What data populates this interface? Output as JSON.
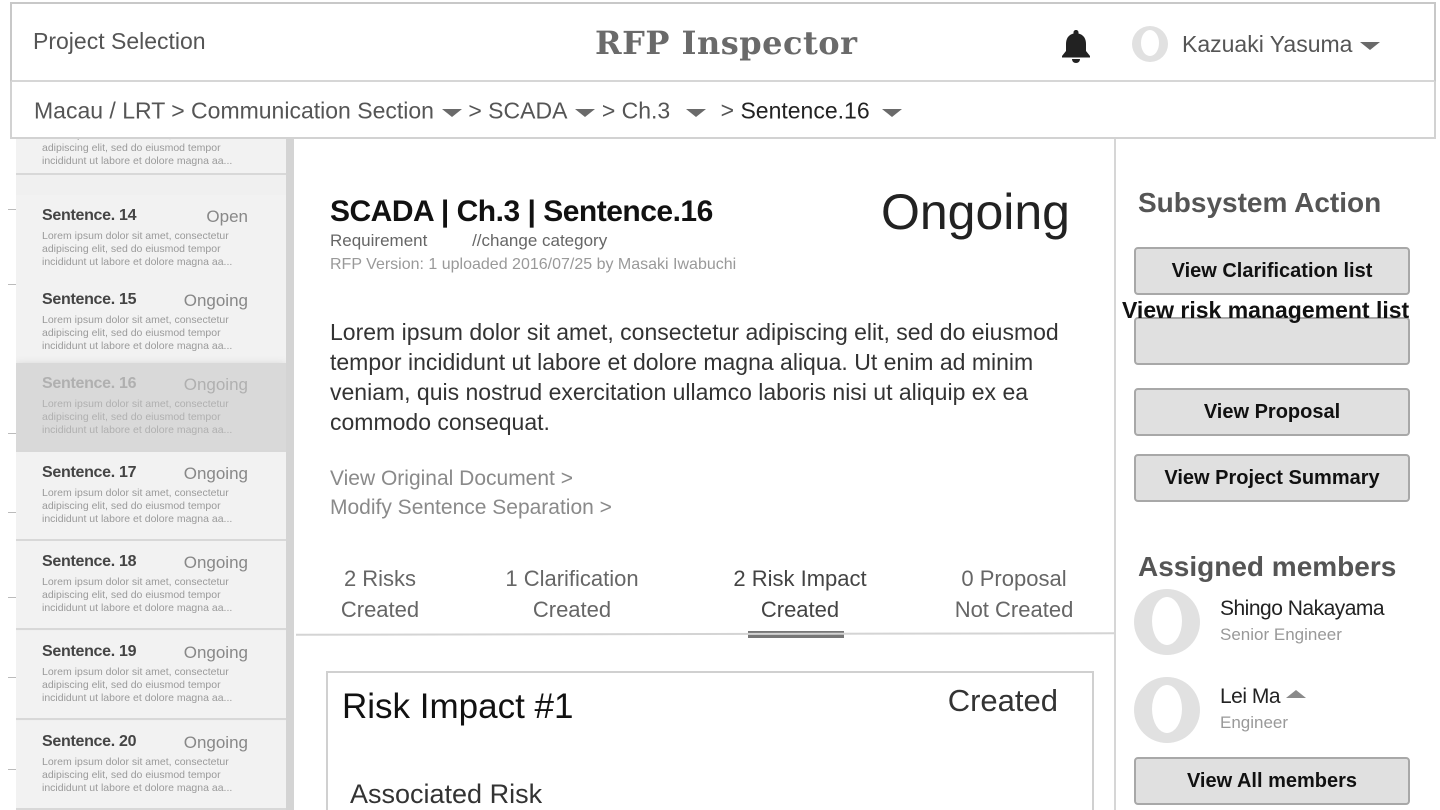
{
  "header": {
    "project_selection": "Project Selection",
    "app_title": "RFP Inspector",
    "user_name": "Kazuaki Yasuma"
  },
  "breadcrumb": {
    "root": "Macau / LRT >",
    "section": "Communication Section",
    "sep1": ">",
    "subsystem": "SCADA",
    "sep2": ">",
    "chapter": "Ch.3",
    "sep3": ">",
    "sentence": "Sentence.16"
  },
  "sidebar": {
    "top_snippet": "Lorem ipsum dolor sit amet, consectetur adipiscing elit, sed do eiusmod tempor incididunt ut labore et dolore magna aa...",
    "items": [
      {
        "title": "Sentence. 14",
        "status": "Open",
        "snippet": "Lorem ipsum dolor sit amet, consectetur adipiscing elit, sed do eiusmod tempor incididunt ut labore et dolore magna aa..."
      },
      {
        "title": "Sentence. 15",
        "status": "Ongoing",
        "snippet": "Lorem ipsum dolor sit amet, consectetur adipiscing elit, sed do eiusmod tempor incididunt ut labore et dolore magna aa..."
      },
      {
        "title": "Sentence. 16",
        "status": "Ongoing",
        "snippet": "Lorem ipsum dolor sit amet, consectetur adipiscing elit, sed do eiusmod tempor incididunt ut labore et dolore magna aa..."
      },
      {
        "title": "Sentence. 17",
        "status": "Ongoing",
        "snippet": "Lorem ipsum dolor sit amet, consectetur adipiscing elit, sed do eiusmod tempor incididunt ut labore et dolore magna aa..."
      },
      {
        "title": "Sentence. 18",
        "status": "Ongoing",
        "snippet": "Lorem ipsum dolor sit amet, consectetur adipiscing elit, sed do eiusmod tempor incididunt ut labore et dolore magna aa..."
      },
      {
        "title": "Sentence. 19",
        "status": "Ongoing",
        "snippet": "Lorem ipsum dolor sit amet, consectetur adipiscing elit, sed do eiusmod tempor incididunt ut labore et dolore magna aa..."
      },
      {
        "title": "Sentence. 20",
        "status": "Ongoing",
        "snippet": "Lorem ipsum dolor sit amet, consectetur adipiscing elit, sed do eiusmod tempor incididunt ut labore et dolore magna aa..."
      }
    ]
  },
  "main": {
    "title": "SCADA | Ch.3 | Sentence.16",
    "status": "Ongoing",
    "category": "Requirement",
    "change_category": "//change category",
    "meta": "RFP Version: 1   uploaded 2016/07/25 by Masaki Iwabuchi",
    "body": "Lorem ipsum dolor sit amet, consectetur adipiscing elit, sed do eiusmod tempor incididunt ut labore et dolore magna aliqua. Ut enim ad minim veniam, quis nostrud exercitation ullamco laboris nisi ut aliquip ex ea commodo consequat.",
    "view_original": "View Original Document >",
    "modify_separation": "Modify Sentence Separation >",
    "tabs": [
      {
        "line1": "2 Risks",
        "line2": "Created"
      },
      {
        "line1": "1 Clarification",
        "line2": "Created"
      },
      {
        "line1": "2 Risk Impact",
        "line2": "Created"
      },
      {
        "line1": "0 Proposal",
        "line2": "Not Created"
      }
    ],
    "card": {
      "title": "Risk Impact #1",
      "status": "Created",
      "sub": "Associated Risk"
    }
  },
  "right": {
    "subsystem_heading": "Subsystem Action",
    "buttons": {
      "clarification": "View Clarification list",
      "risk": "View risk management list",
      "proposal": "View Proposal",
      "summary": "View Project Summary",
      "all_members": "View All members"
    },
    "members_heading": "Assigned members",
    "members": [
      {
        "name": "Shingo Nakayama",
        "role": "Senior Engineer"
      },
      {
        "name": "Lei Ma",
        "role": "Engineer"
      }
    ]
  }
}
